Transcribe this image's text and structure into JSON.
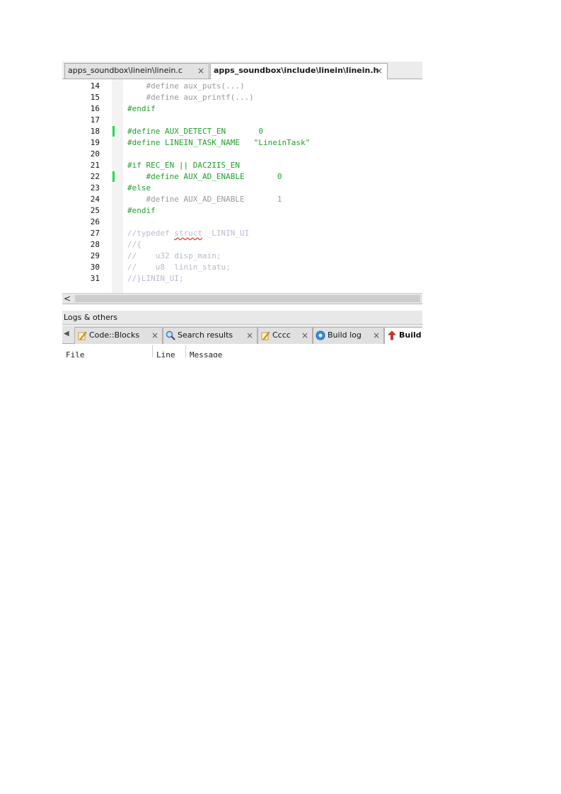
{
  "editor_tabs": [
    {
      "label": "apps_soundbox\\linein\\linein.c",
      "active": false
    },
    {
      "label": "apps_soundbox\\include\\linein\\linein.h",
      "active": true
    }
  ],
  "close_glyph": "×",
  "code_lines": [
    {
      "num": "14",
      "text": "    #define aux_puts(...)",
      "style": "dim",
      "changed": false
    },
    {
      "num": "15",
      "text": "    #define aux_printf(...)",
      "style": "dim",
      "changed": false
    },
    {
      "num": "16",
      "text": "#endif",
      "style": "pre",
      "changed": false
    },
    {
      "num": "17",
      "text": "",
      "style": "pre",
      "changed": false
    },
    {
      "num": "18",
      "text": "#define AUX_DETECT_EN       0",
      "style": "pre",
      "changed": true
    },
    {
      "num": "19",
      "text": "#define LINEIN_TASK_NAME   \"LineinTask\"",
      "style": "pre",
      "changed": false
    },
    {
      "num": "20",
      "text": "",
      "style": "pre",
      "changed": false
    },
    {
      "num": "21",
      "text": "#if REC_EN || DAC2IIS_EN",
      "style": "pre",
      "changed": false
    },
    {
      "num": "22",
      "text": "    #define AUX_AD_ENABLE       0",
      "style": "pre",
      "changed": true
    },
    {
      "num": "23",
      "text": "#else",
      "style": "pre",
      "changed": false
    },
    {
      "num": "24",
      "text": "    #define AUX_AD_ENABLE       1",
      "style": "dim",
      "changed": false
    },
    {
      "num": "25",
      "text": "#endif",
      "style": "pre",
      "changed": false
    },
    {
      "num": "26",
      "text": "",
      "style": "pre",
      "changed": false
    },
    {
      "num": "27",
      "text": "//typedef struct _LININ_UI",
      "style": "com",
      "changed": false
    },
    {
      "num": "28",
      "text": "//{",
      "style": "com",
      "changed": false
    },
    {
      "num": "29",
      "text": "//    u32 disp_main;",
      "style": "com",
      "changed": false
    },
    {
      "num": "30",
      "text": "//    u8  linin_statu;",
      "style": "com",
      "changed": false
    },
    {
      "num": "31",
      "text": "//}LININ_UI;",
      "style": "com",
      "changed": false
    }
  ],
  "scroll_left_glyph": "<",
  "logs_panel": {
    "title": "Logs & others",
    "tabs": [
      {
        "label": "Code::Blocks",
        "icon": "code-blocks-icon",
        "active": false
      },
      {
        "label": "Search results",
        "icon": "search-icon",
        "active": false
      },
      {
        "label": "Cccc",
        "icon": "cccc-icon",
        "active": false
      },
      {
        "label": "Build log",
        "icon": "build-log-icon",
        "active": false
      },
      {
        "label": "Build",
        "icon": "build-messages-icon",
        "active": true
      }
    ],
    "columns": [
      "File",
      "Line",
      "Message"
    ]
  },
  "colors": {
    "preprocessor": "#1f9f2a",
    "inactive_code": "#9a9a9a",
    "comment": "#b9b9d2",
    "changed_marker": "#1fe04a"
  }
}
